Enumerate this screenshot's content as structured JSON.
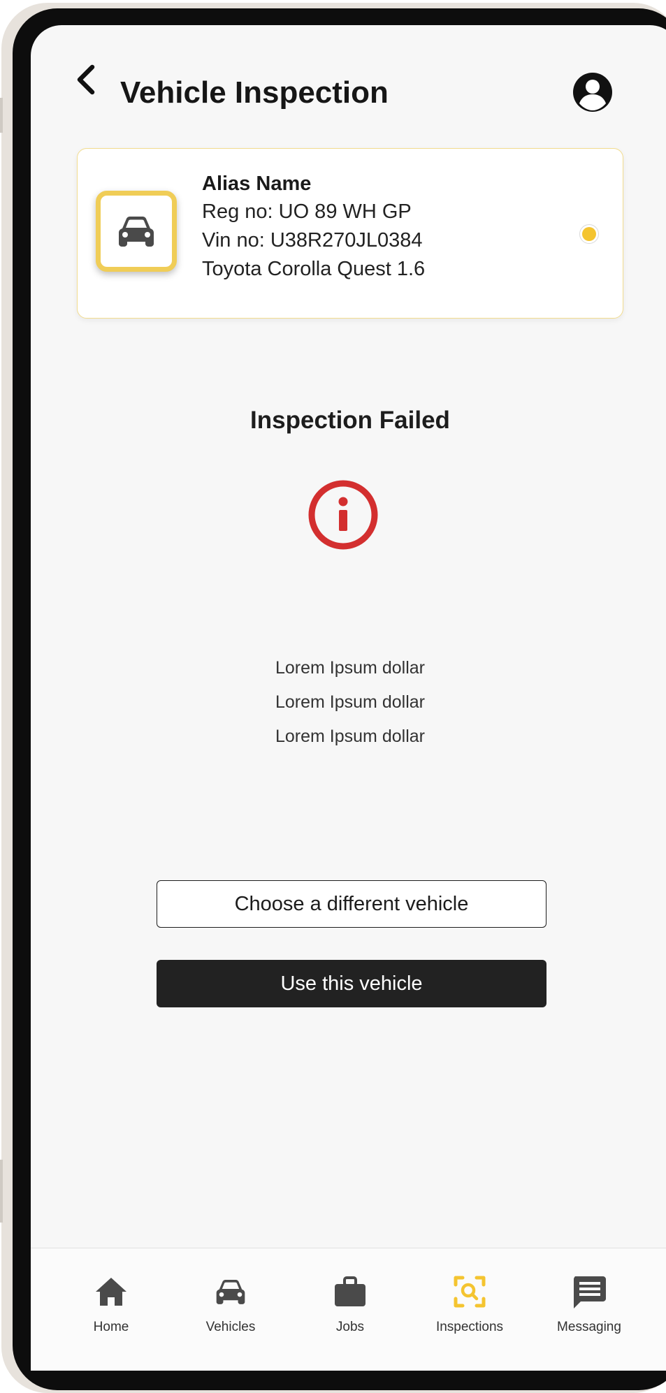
{
  "header": {
    "title": "Vehicle Inspection",
    "back_icon": "chevron-left-icon",
    "profile_icon": "user-circle-icon"
  },
  "vehicle_card": {
    "alias": "Alias Name",
    "reg": "Reg no: UO 89 WH GP",
    "vin": "Vin no: U38R270JL0384",
    "model": "Toyota Corolla Quest 1.6",
    "icon": "car-icon",
    "selected": true
  },
  "status": {
    "title": "Inspection Failed",
    "icon": "error-info-icon",
    "messages": [
      "Lorem Ipsum dollar",
      "Lorem Ipsum dollar",
      "Lorem Ipsum dollar"
    ]
  },
  "actions": {
    "choose_label": "Choose a different vehicle",
    "use_label": "Use this vehicle"
  },
  "nav": {
    "items": [
      {
        "label": "Home",
        "icon": "home-icon",
        "active": false
      },
      {
        "label": "Vehicles",
        "icon": "car-icon",
        "active": false
      },
      {
        "label": "Jobs",
        "icon": "briefcase-icon",
        "active": false
      },
      {
        "label": "Inspections",
        "icon": "inspection-scan-icon",
        "active": true
      },
      {
        "label": "Messaging",
        "icon": "message-icon",
        "active": false
      }
    ]
  },
  "colors": {
    "accent": "#f4c430",
    "error": "#d32f2f",
    "dark": "#222222",
    "inactive_icon": "#4a4a4a"
  }
}
